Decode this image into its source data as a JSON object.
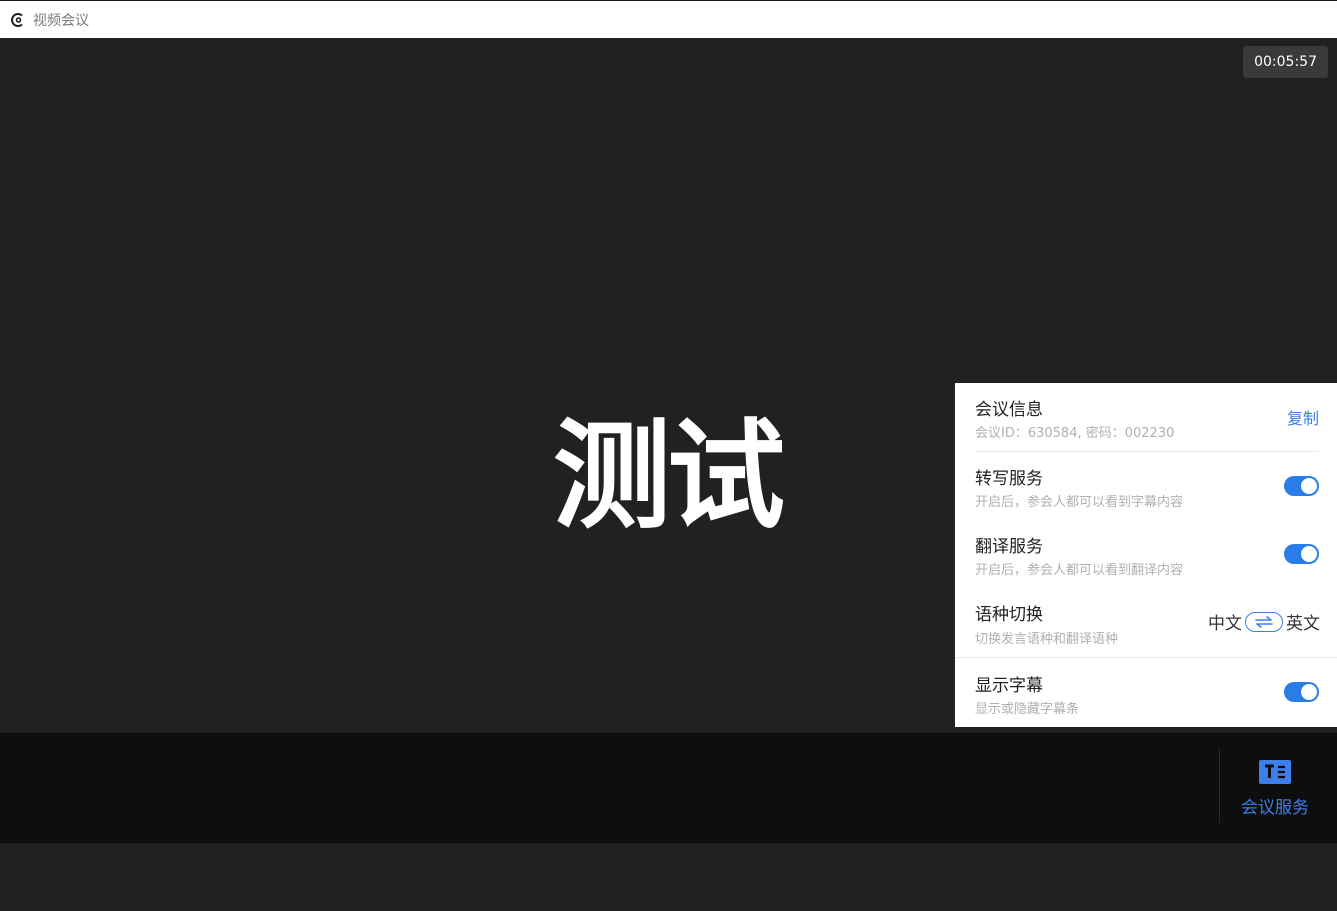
{
  "window": {
    "title": "视频会议",
    "icon": "app-logo-icon"
  },
  "video": {
    "timer": "00:05:57",
    "caption": "测试"
  },
  "panel": {
    "meeting_info": {
      "label": "会议信息",
      "desc": "会议ID：630584, 密码：002230",
      "copy_label": "复制"
    },
    "transcribe": {
      "label": "转写服务",
      "desc": "开启后，参会人都可以看到字幕内容",
      "enabled": true
    },
    "translate": {
      "label": "翻译服务",
      "desc": "开启后，参会人都可以看到翻译内容",
      "enabled": true
    },
    "language": {
      "label": "语种切换",
      "desc": "切换发言语种和翻译语种",
      "source": "中文",
      "target": "英文",
      "icon": "swap-icon"
    },
    "subtitles": {
      "label": "显示字幕",
      "desc": "显示或隐藏字幕条",
      "enabled": true
    }
  },
  "toolbar": {
    "meeting_service_label": "会议服务",
    "meeting_service_icon": "caption-text-icon"
  },
  "colors": {
    "accent": "#2a7ce8",
    "video_bg": "#212121",
    "toolbar_bg": "#0e0e0e"
  }
}
